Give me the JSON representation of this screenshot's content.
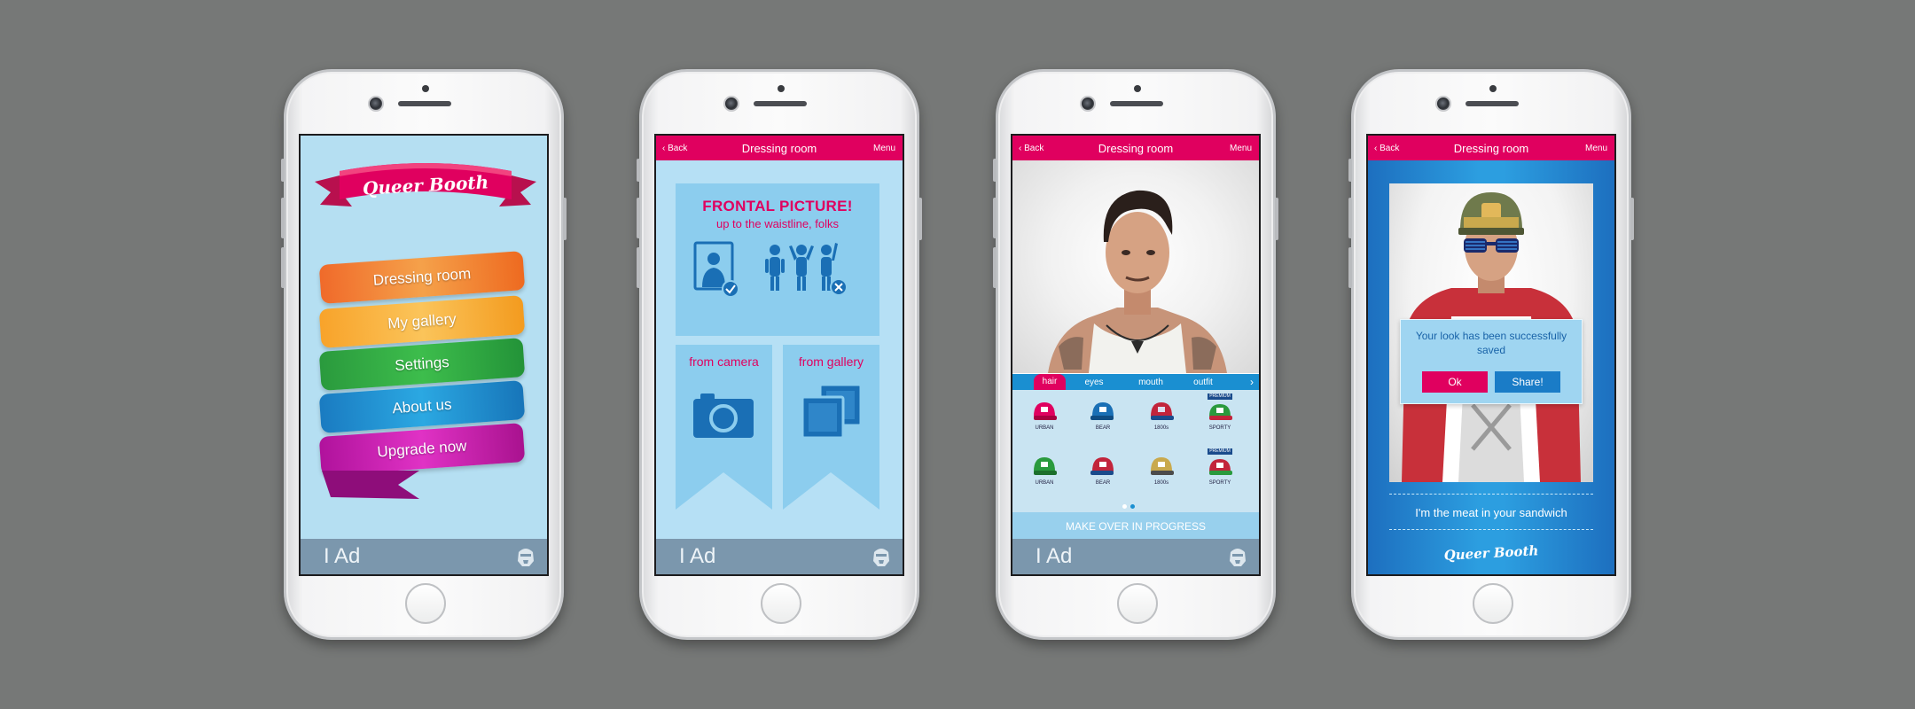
{
  "colors": {
    "background": "#767877",
    "accent": "#e0005f",
    "sky": "#b6e0f3",
    "blue": "#1a8fd1"
  },
  "logo_text": "Queer Booth",
  "menu_screen": {
    "items": [
      {
        "label": "Dressing room",
        "color": "#f06a2a"
      },
      {
        "label": "My gallery",
        "color": "#f8a32a"
      },
      {
        "label": "Settings",
        "color": "#2a9a3d"
      },
      {
        "label": "About us",
        "color": "#1a7bc1"
      },
      {
        "label": "Upgrade now",
        "color": "#b0129c"
      }
    ]
  },
  "ad_bar": {
    "label": "I Ad",
    "icon": "stormtrooper-icon"
  },
  "nav": {
    "back": "‹ Back",
    "title": "Dressing room",
    "menu": "Menu"
  },
  "capture_screen": {
    "headline": "FRONTAL PICTURE!",
    "subline": "up to the waistline, folks",
    "from_camera": "from camera",
    "from_gallery": "from gallery"
  },
  "dressing_screen": {
    "tabs": [
      "hair",
      "eyes",
      "mouth",
      "outfit"
    ],
    "active_tab": "hair",
    "items": [
      {
        "name": "URBAN",
        "color": "#e0005f",
        "premium": false
      },
      {
        "name": "BEAR",
        "color": "#1a6fb5",
        "premium": false
      },
      {
        "name": "1800s",
        "color": "#c2243b",
        "premium": false
      },
      {
        "name": "SPORTY",
        "color": "#2a9a3d",
        "premium": true
      },
      {
        "name": "URBAN",
        "color": "#2a9a3d",
        "premium": false
      },
      {
        "name": "BEAR",
        "color": "#c2243b",
        "premium": false
      },
      {
        "name": "1800s",
        "color": "#c9a94d",
        "premium": false
      },
      {
        "name": "SPORTY",
        "color": "#c2243b",
        "premium": true
      }
    ],
    "premium_badge": "PREMIUM",
    "page_count": 2,
    "current_page": 2,
    "status": "MAKE OVER IN PROGRESS"
  },
  "saved_screen": {
    "message": "Your look has been successfully saved",
    "ok": "Ok",
    "share": "Share!",
    "quote": "I'm the meat in your sandwich"
  }
}
